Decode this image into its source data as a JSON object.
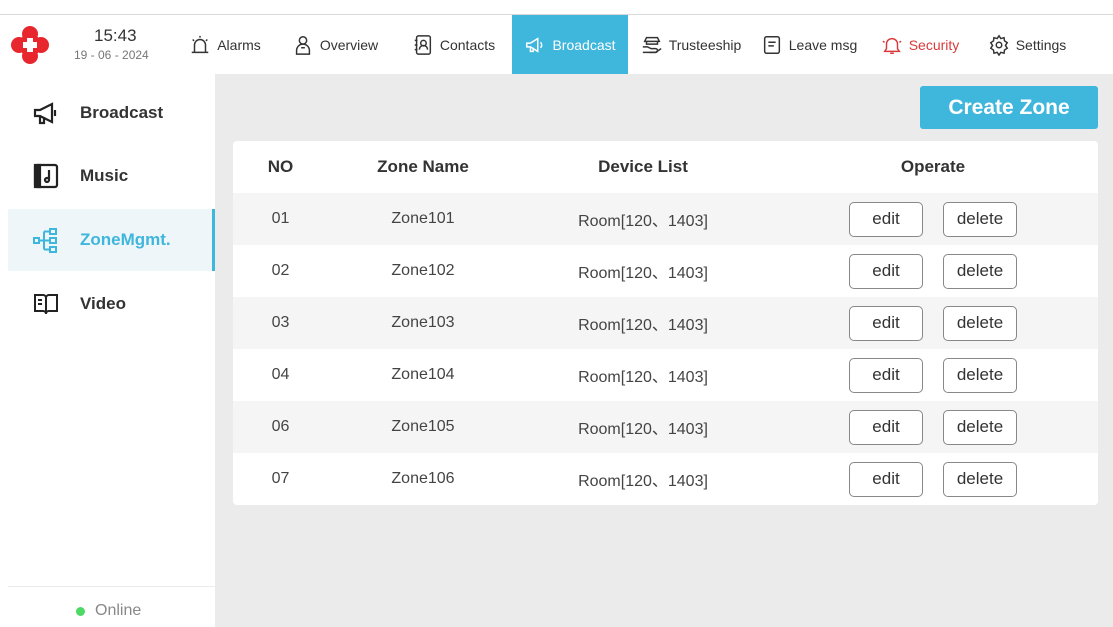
{
  "header": {
    "time": "15:43",
    "date": "19 - 06 - 2024",
    "nav": [
      {
        "label": "Alarms",
        "icon": "alarm-icon"
      },
      {
        "label": "Overview",
        "icon": "overview-icon"
      },
      {
        "label": "Contacts",
        "icon": "contacts-icon"
      },
      {
        "label": "Broadcast",
        "icon": "broadcast-icon",
        "active": true
      },
      {
        "label": "Trusteeship",
        "icon": "trusteeship-icon"
      },
      {
        "label": "Leave msg",
        "icon": "leave-msg-icon"
      },
      {
        "label": "Security",
        "icon": "security-bell-icon"
      },
      {
        "label": "Settings",
        "icon": "settings-gear-icon"
      }
    ]
  },
  "sidebar": {
    "items": [
      {
        "label": "Broadcast",
        "icon": "megaphone-icon"
      },
      {
        "label": "Music",
        "icon": "music-icon"
      },
      {
        "label": "ZoneMgmt.",
        "icon": "zone-tree-icon",
        "active": true
      },
      {
        "label": "Video",
        "icon": "book-video-icon"
      }
    ],
    "status": "Online"
  },
  "main": {
    "create_button": "Create Zone",
    "columns": [
      "NO",
      "Zone Name",
      "Device List",
      "Operate"
    ],
    "rows": [
      {
        "no": "01",
        "name": "Zone101",
        "devices": "Room[120、1403]"
      },
      {
        "no": "02",
        "name": "Zone102",
        "devices": "Room[120、1403]"
      },
      {
        "no": "03",
        "name": "Zone103",
        "devices": "Room[120、1403]"
      },
      {
        "no": "04",
        "name": "Zone104",
        "devices": "Room[120、1403]"
      },
      {
        "no": "06",
        "name": "Zone105",
        "devices": "Room[120、1403]"
      },
      {
        "no": "07",
        "name": "Zone106",
        "devices": "Room[120、1403]"
      }
    ],
    "edit_label": "edit",
    "delete_label": "delete"
  },
  "colors": {
    "accent": "#3fb6dc",
    "security": "#d93a3a",
    "online": "#4cd964",
    "logo": "#e8262e"
  }
}
